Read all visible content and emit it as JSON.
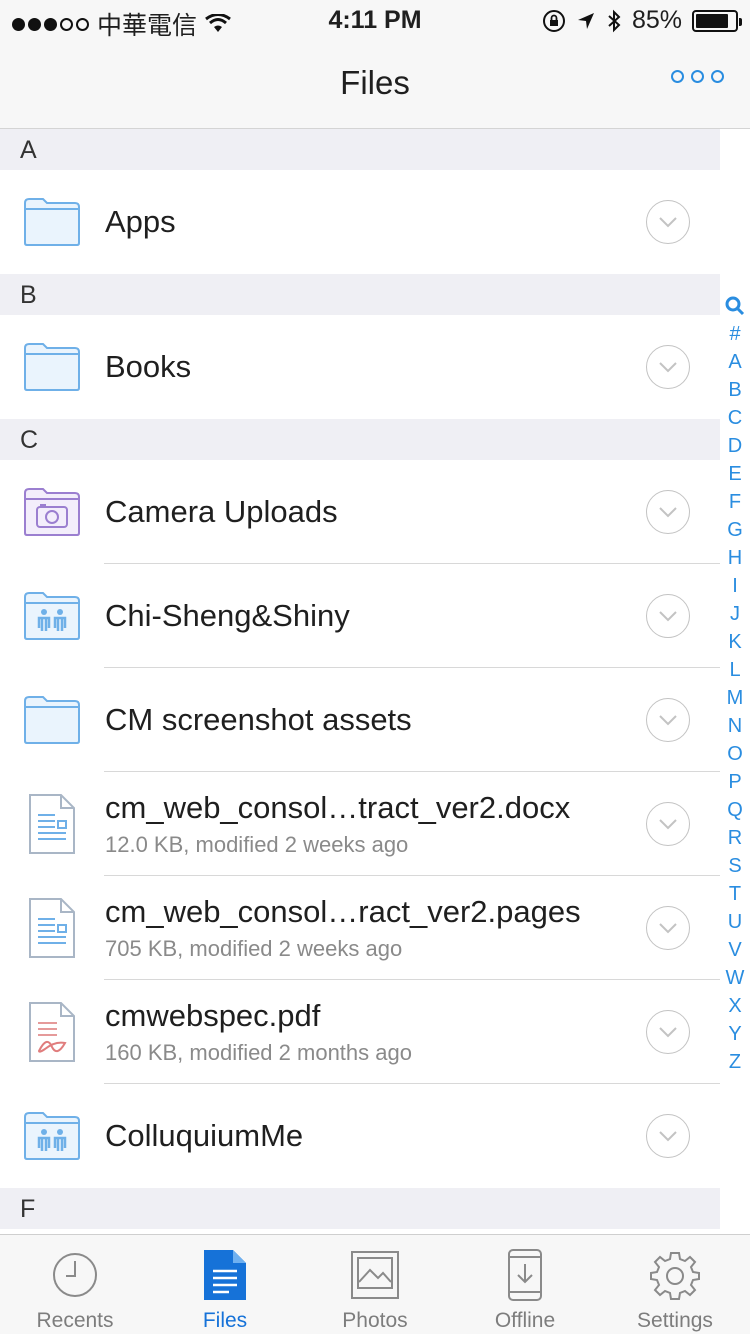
{
  "status_bar": {
    "carrier": "中華電信",
    "time": "4:11 PM",
    "battery_percent": "85%",
    "battery_level": 0.85,
    "signal_bars_filled": 3,
    "signal_bars_total": 5
  },
  "nav": {
    "title": "Files",
    "more_icon": "more-dots-icon"
  },
  "sections": [
    {
      "letter": "A",
      "items": [
        {
          "name": "Apps",
          "type": "folder",
          "meta": ""
        }
      ]
    },
    {
      "letter": "B",
      "items": [
        {
          "name": "Books",
          "type": "folder",
          "meta": ""
        }
      ]
    },
    {
      "letter": "C",
      "items": [
        {
          "name": "Camera Uploads",
          "type": "camera-folder",
          "meta": ""
        },
        {
          "name": "Chi-Sheng&Shiny",
          "type": "shared-folder",
          "meta": ""
        },
        {
          "name": "CM screenshot assets",
          "type": "folder",
          "meta": ""
        },
        {
          "name": "cm_web_consol…tract_ver2.docx",
          "type": "document",
          "meta": "12.0 KB, modified 2 weeks ago"
        },
        {
          "name": "cm_web_consol…ract_ver2.pages",
          "type": "document",
          "meta": "705 KB, modified 2 weeks ago"
        },
        {
          "name": "cmwebspec.pdf",
          "type": "pdf",
          "meta": "160 KB, modified 2 months ago"
        },
        {
          "name": "ColluquiumMe",
          "type": "shared-folder",
          "meta": ""
        }
      ]
    },
    {
      "letter": "F",
      "items": []
    }
  ],
  "index": [
    "Q",
    "#",
    "A",
    "B",
    "C",
    "D",
    "E",
    "F",
    "G",
    "H",
    "I",
    "J",
    "K",
    "L",
    "M",
    "N",
    "O",
    "P",
    "Q",
    "R",
    "S",
    "T",
    "U",
    "V",
    "W",
    "X",
    "Y",
    "Z"
  ],
  "tabs": [
    {
      "label": "Recents",
      "icon": "clock-icon",
      "active": false
    },
    {
      "label": "Files",
      "icon": "files-icon",
      "active": true
    },
    {
      "label": "Photos",
      "icon": "photos-icon",
      "active": false
    },
    {
      "label": "Offline",
      "icon": "offline-icon",
      "active": false
    },
    {
      "label": "Settings",
      "icon": "gear-icon",
      "active": false
    }
  ],
  "colors": {
    "accent": "#2a8de0",
    "active_tab": "#1672d8",
    "folder_stroke": "#6fb0e8",
    "folder_fill": "#eaf4fd",
    "camera_stroke": "#9b7fd0",
    "section_bg": "#efeff4"
  }
}
